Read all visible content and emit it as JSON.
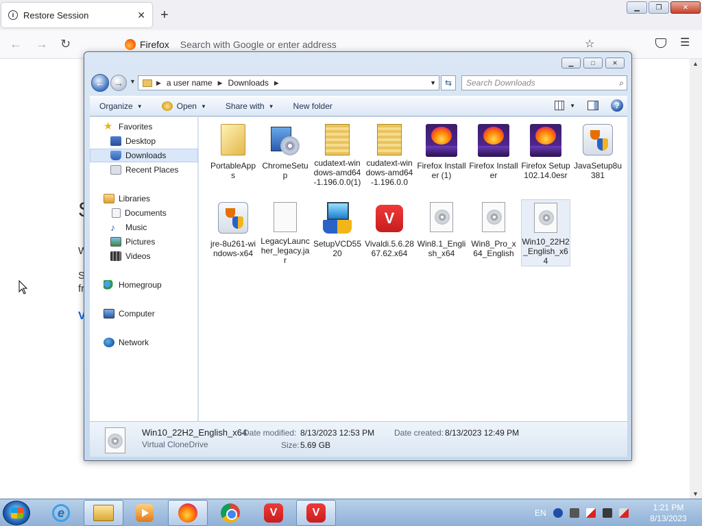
{
  "firefox": {
    "tab_title": "Restore Session",
    "url_brand": "Firefox",
    "url_placeholder": "Search with Google or enter address",
    "background_fragments": [
      "S",
      "W",
      "S",
      "fr",
      "V"
    ]
  },
  "explorer": {
    "breadcrumb": [
      "a user name",
      "Downloads"
    ],
    "search_placeholder": "Search Downloads",
    "toolbar": {
      "organize": "Organize",
      "open": "Open",
      "share_with": "Share with",
      "new_folder": "New folder"
    },
    "nav": {
      "favorites": "Favorites",
      "desktop": "Desktop",
      "downloads": "Downloads",
      "recent_places": "Recent Places",
      "libraries": "Libraries",
      "documents": "Documents",
      "music": "Music",
      "pictures": "Pictures",
      "videos": "Videos",
      "homegroup": "Homegroup",
      "computer": "Computer",
      "network": "Network"
    },
    "files": [
      {
        "name": "PortableApps",
        "icon": "folder-icon"
      },
      {
        "name": "ChromeSetup",
        "icon": "installer-icon"
      },
      {
        "name": "cudatext-windows-amd64-1.196.0.0(1)",
        "icon": "zip-folder-icon"
      },
      {
        "name": "cudatext-windows-amd64-1.196.0.0",
        "icon": "zip-folder-icon"
      },
      {
        "name": "Firefox Installer (1)",
        "icon": "firefox-installer-icon"
      },
      {
        "name": "Firefox Installer",
        "icon": "firefox-installer-icon"
      },
      {
        "name": "Firefox Setup 102.14.0esr",
        "icon": "firefox-installer-icon"
      },
      {
        "name": "JavaSetup8u381",
        "icon": "java-installer-icon"
      },
      {
        "name": "jre-8u261-windows-x64",
        "icon": "java-installer-icon"
      },
      {
        "name": "LegacyLauncher_legacy.jar",
        "icon": "jar-file-icon"
      },
      {
        "name": "SetupVCD5520",
        "icon": "setup-icon"
      },
      {
        "name": "Vivaldi.5.6.2867.62.x64",
        "icon": "vivaldi-icon"
      },
      {
        "name": "Win8.1_English_x64",
        "icon": "disc-image-icon"
      },
      {
        "name": "Win8_Pro_x64_English",
        "icon": "disc-image-icon"
      },
      {
        "name": "Win10_22H2_English_x64",
        "icon": "disc-image-icon"
      }
    ],
    "details": {
      "name": "Win10_22H2_English_x64",
      "type": "Virtual CloneDrive",
      "date_modified_label": "Date modified:",
      "date_modified": "8/13/2023 12:53 PM",
      "date_created_label": "Date created:",
      "date_created": "8/13/2023 12:49 PM",
      "size_label": "Size:",
      "size": "5.69 GB"
    }
  },
  "taskbar": {
    "language": "EN",
    "time": "1:21 PM",
    "date": "8/13/2023"
  }
}
